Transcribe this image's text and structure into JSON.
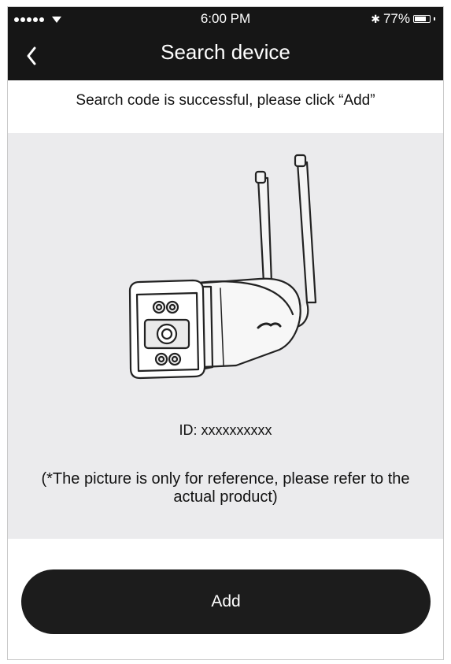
{
  "status_bar": {
    "time": "6:00 PM",
    "battery": "77%",
    "battery_level": 0.77
  },
  "nav": {
    "title": "Search device",
    "back_icon": "chevron-left-icon"
  },
  "content": {
    "message": "Search code is successful, please click “Add”",
    "device_id": "ID: xxxxxxxxxx",
    "disclaimer": "(*The picture is only for reference, please refer to the actual product)"
  },
  "actions": {
    "add_label": "Add"
  },
  "colors": {
    "header_bg": "#161616",
    "panel_bg": "#ebebed",
    "button_bg": "#1c1c1c",
    "text": "#111111"
  }
}
